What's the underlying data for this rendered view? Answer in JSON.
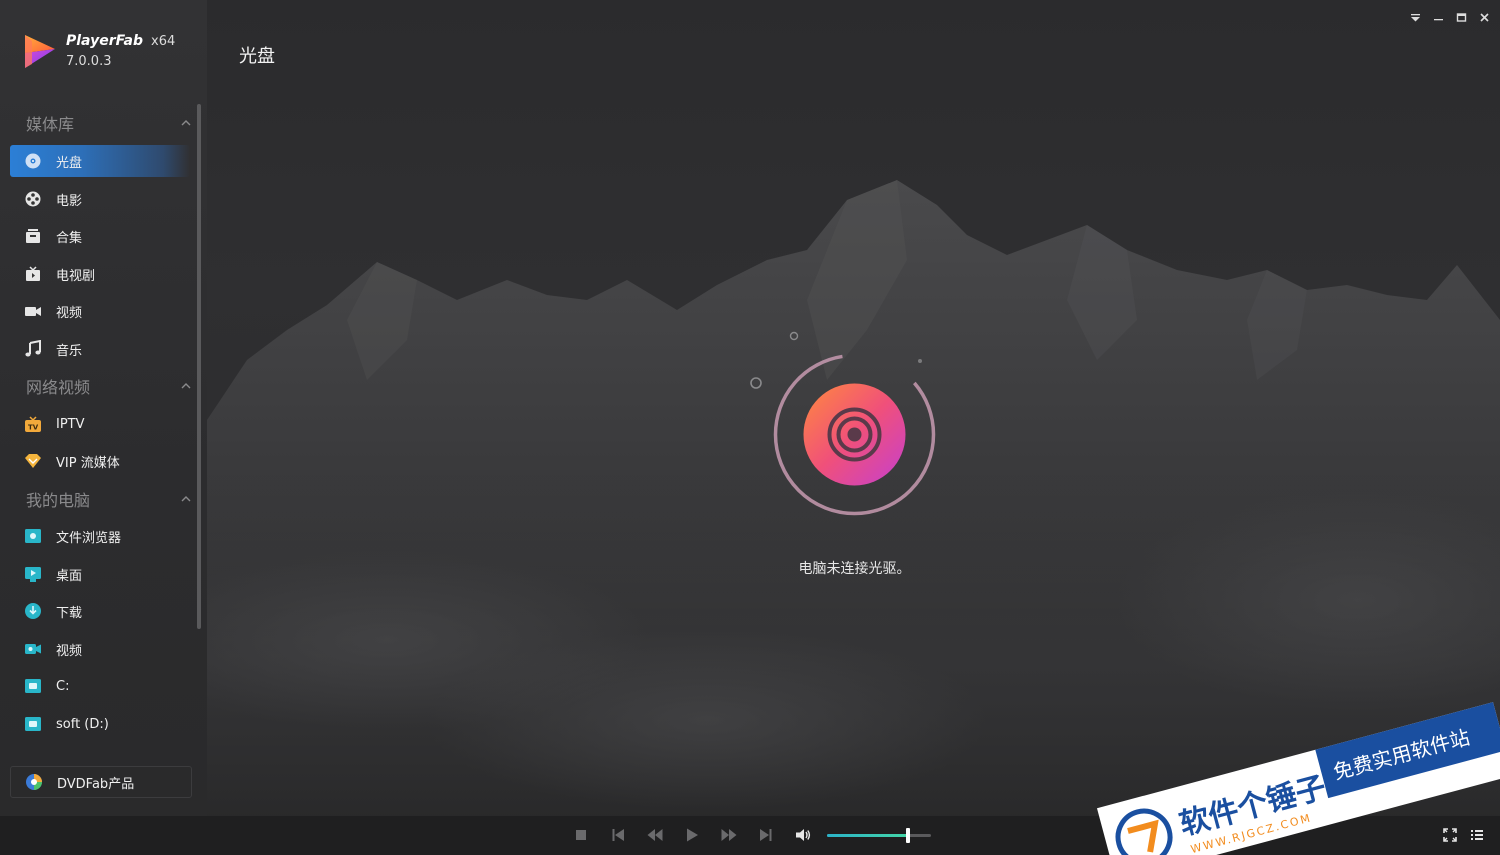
{
  "app": {
    "name": "PlayerFab",
    "arch": "x64",
    "version": "7.0.0.3"
  },
  "window_controls": [
    "dropdown",
    "minimize",
    "maximize",
    "close"
  ],
  "sidebar": {
    "sections": [
      {
        "title": "媒体库",
        "items": [
          {
            "label": "光盘",
            "icon": "disc-icon",
            "active": true
          },
          {
            "label": "电影",
            "icon": "film-reel-icon"
          },
          {
            "label": "合集",
            "icon": "collection-icon"
          },
          {
            "label": "电视剧",
            "icon": "tv-series-icon"
          },
          {
            "label": "视频",
            "icon": "video-camera-icon"
          },
          {
            "label": "音乐",
            "icon": "music-note-icon"
          }
        ]
      },
      {
        "title": "网络视频",
        "items": [
          {
            "label": "IPTV",
            "icon": "iptv-icon"
          },
          {
            "label": "VIP 流媒体",
            "icon": "vip-diamond-icon"
          }
        ]
      },
      {
        "title": "我的电脑",
        "items": [
          {
            "label": "文件浏览器",
            "icon": "file-browser-icon"
          },
          {
            "label": "桌面",
            "icon": "desktop-icon"
          },
          {
            "label": "下载",
            "icon": "download-icon"
          },
          {
            "label": "视频",
            "icon": "folder-video-icon"
          },
          {
            "label": "C:",
            "icon": "drive-icon"
          },
          {
            "label": "soft (D:)",
            "icon": "drive-icon"
          }
        ]
      }
    ],
    "footer_button": "DVDFab产品"
  },
  "main": {
    "title": "光盘",
    "status": "电脑未连接光驱。"
  },
  "player": {
    "volume": 0.78
  },
  "watermark": {
    "title": "软件个锤子",
    "url": "WWW.RJGCZ.COM",
    "slogan": "免费实用软件站"
  },
  "colors": {
    "accent": "#2c7fd6",
    "disc_gradient_start": "#ff8a3d",
    "disc_gradient_end": "#d43cc8",
    "volume_fill": "#2bb3c9"
  }
}
